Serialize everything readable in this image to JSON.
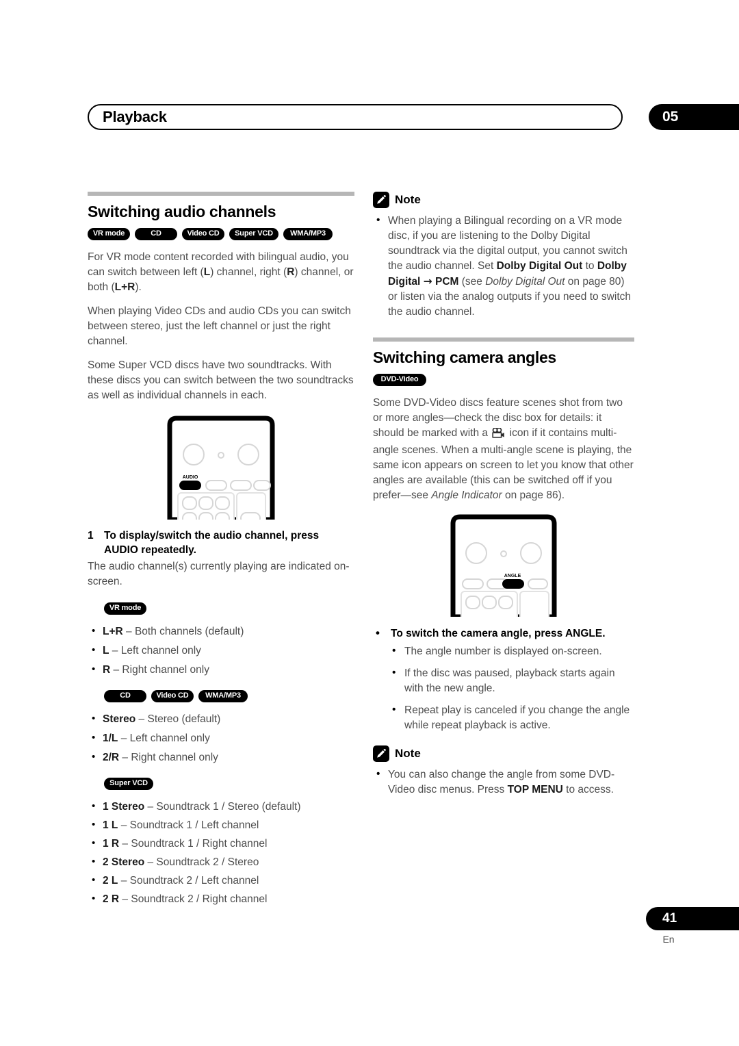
{
  "header": {
    "title": "Playback",
    "chapter": "05"
  },
  "footer": {
    "page_number": "41",
    "language": "En"
  },
  "left": {
    "section_title": "Switching audio channels",
    "badges": [
      "VR mode",
      "CD",
      "Video CD",
      "Super VCD",
      "WMA/MP3"
    ],
    "para1_a": "For VR mode content recorded with bilingual audio, you can switch between left (",
    "para1_L": "L",
    "para1_b": ") channel, right (",
    "para1_R": "R",
    "para1_c": ") channel, or both (",
    "para1_LR": "L+R",
    "para1_d": ").",
    "para2": "When playing Video CDs and audio CDs you can switch between stereo, just the left channel or just the right channel.",
    "para3": "Some Super VCD discs have two soundtracks. With these discs you can switch between the two soundtracks as well as individual channels in each.",
    "remote_button_label": "AUDIO",
    "step_number": "1",
    "step_text": "To display/switch the audio channel, press AUDIO repeatedly.",
    "step_sub": "The audio channel(s) currently playing are indicated on-screen.",
    "vr_badge": "VR mode",
    "vr_items": [
      {
        "term": "L+R",
        "desc": " – Both channels (default)"
      },
      {
        "term": "L",
        "desc": " – Left channel only"
      },
      {
        "term": "R",
        "desc": " – Right channel only"
      }
    ],
    "cd_badges": [
      "CD",
      "Video CD",
      "WMA/MP3"
    ],
    "cd_items": [
      {
        "term": "Stereo",
        "desc": " – Stereo (default)"
      },
      {
        "term": "1/L",
        "desc": " – Left channel only"
      },
      {
        "term": "2/R",
        "desc": " – Right channel only"
      }
    ],
    "svcd_badge": "Super VCD",
    "svcd_items": [
      {
        "term": "1 Stereo",
        "desc": " – Soundtrack 1 / Stereo (default)"
      },
      {
        "term": "1 L",
        "desc": " – Soundtrack 1 / Left channel"
      },
      {
        "term": "1 R",
        "desc": " – Soundtrack 1 / Right channel"
      },
      {
        "term": "2 Stereo",
        "desc": " – Soundtrack 2 / Stereo"
      },
      {
        "term": "2 L",
        "desc": " – Soundtrack 2 / Left channel"
      },
      {
        "term": "2 R",
        "desc": " – Soundtrack 2 / Right channel"
      }
    ]
  },
  "right": {
    "note1_label": "Note",
    "note1_a": "When playing a Bilingual recording on a VR mode disc, if you are listening to the Dolby Digital soundtrack via the digital output, you cannot switch the audio channel. Set ",
    "note1_b1": "Dolby Digital Out",
    "note1_b": " to ",
    "note1_b2": "Dolby Digital ",
    "note1_arrow": "→",
    "note1_b3": " PCM",
    "note1_c": " (see ",
    "note1_i": "Dolby Digital Out",
    "note1_d": " on page 80) or listen via the analog outputs if you need to switch the audio channel.",
    "section_title": "Switching camera angles",
    "badge": "DVD-Video",
    "para_a": "Some DVD-Video discs feature scenes shot from two or more angles—check the disc box for details: it should be marked with a ",
    "para_b": " icon if it contains multi-angle scenes. When a multi-angle scene is playing, the same icon appears on screen to let you know that other angles are available (this can be switched off if you prefer—see ",
    "para_i": "Angle Indicator",
    "para_c": " on page 86).",
    "remote_button_label": "ANGLE",
    "lead_bullet": "To switch the camera angle, press ANGLE.",
    "sub_items": [
      "The angle number is displayed on-screen.",
      "If the disc was paused, playback starts again with the new angle.",
      "Repeat play is canceled if you change the angle while repeat playback is active."
    ],
    "note2_label": "Note",
    "note2_a": "You can also change the angle from some DVD-Video disc menus. Press ",
    "note2_b": "TOP MENU",
    "note2_c": " to access."
  }
}
